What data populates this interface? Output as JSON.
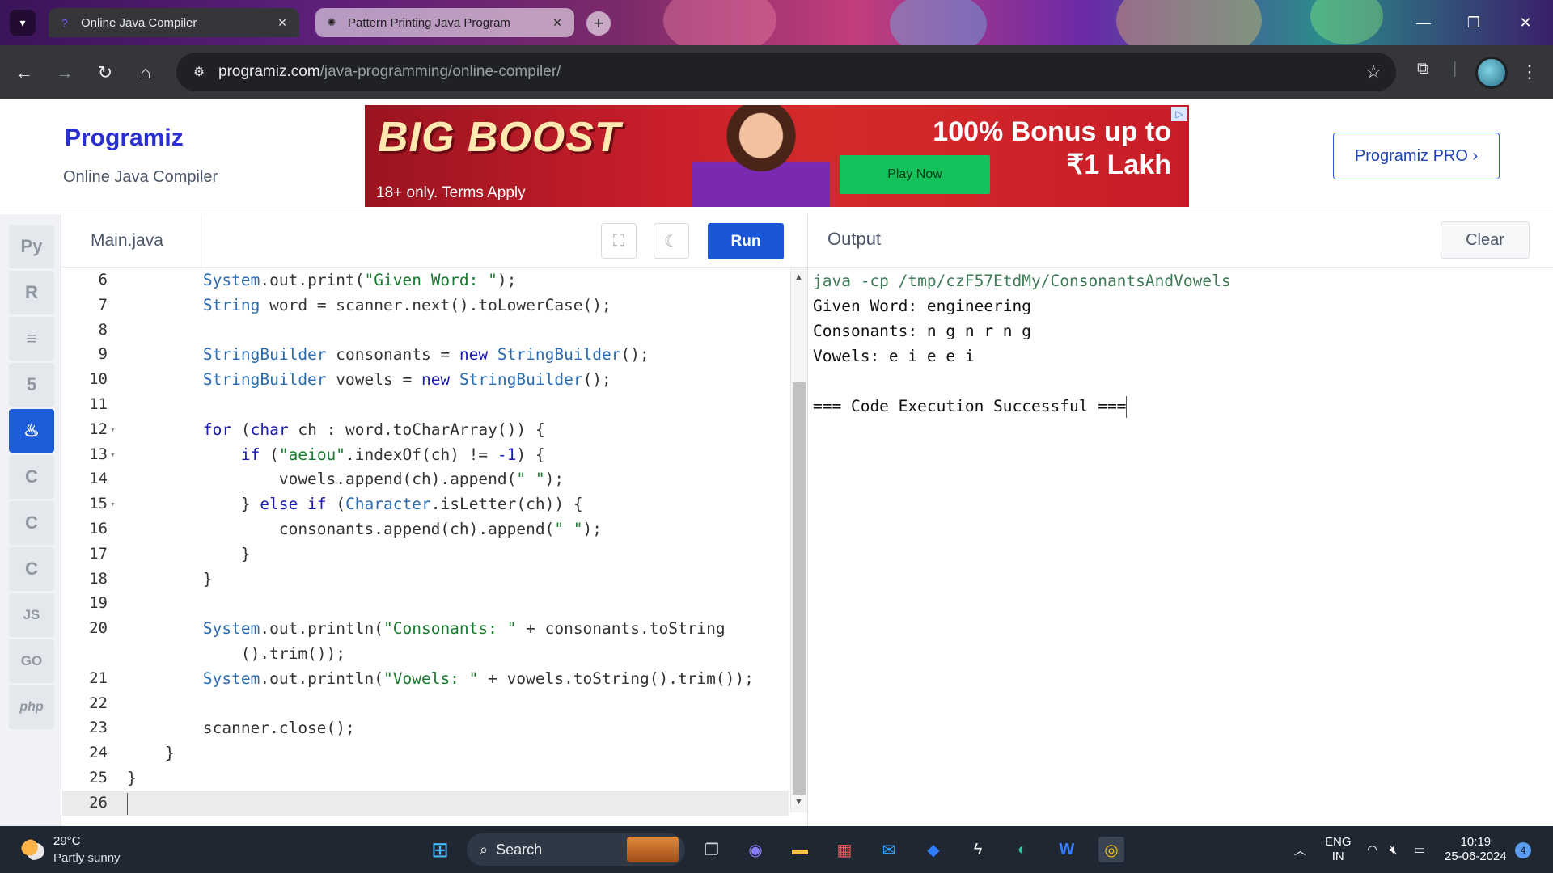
{
  "browser": {
    "tabs": [
      {
        "title": "Online Java Compiler",
        "active": true
      },
      {
        "title": "Pattern Printing Java Program",
        "active": false
      }
    ],
    "url_host": "programiz.com",
    "url_path": "/java-programming/online-compiler/"
  },
  "header": {
    "logo": "Programiz",
    "subtitle": "Online Java Compiler",
    "pro_button": "Programiz PRO ›"
  },
  "ad": {
    "headline": "BIG BOOST",
    "terms": "18+ only. Terms Apply",
    "cta": "Play Now",
    "bonus_line1": "100% Bonus up to",
    "bonus_line2": "₹1 Lakh"
  },
  "languages": [
    {
      "name": "python-icon",
      "label": "Py",
      "active": false
    },
    {
      "name": "r-icon",
      "label": "R",
      "active": false
    },
    {
      "name": "sql-icon",
      "label": "≡",
      "active": false
    },
    {
      "name": "html-icon",
      "label": "5",
      "active": false
    },
    {
      "name": "java-icon",
      "label": "♨",
      "active": true
    },
    {
      "name": "c-icon",
      "label": "C",
      "active": false
    },
    {
      "name": "cpp-icon",
      "label": "C",
      "active": false
    },
    {
      "name": "csharp-icon",
      "label": "C",
      "active": false
    },
    {
      "name": "js-icon",
      "label": "JS",
      "active": false
    },
    {
      "name": "go-icon",
      "label": "GO",
      "active": false
    },
    {
      "name": "php-icon",
      "label": "php",
      "active": false
    }
  ],
  "editor": {
    "file_name": "Main.java",
    "run_label": "Run"
  },
  "output": {
    "title": "Output",
    "clear_label": "Clear",
    "lines": [
      {
        "text": "java -cp /tmp/czF57EtdMy/ConsonantsAndVowels",
        "type": "cmd"
      },
      {
        "text": "Given Word: engineering",
        "type": "out"
      },
      {
        "text": "Consonants: n g n r n g",
        "type": "out"
      },
      {
        "text": "Vowels: e i e e i",
        "type": "out"
      },
      {
        "text": "",
        "type": "out"
      },
      {
        "text": "=== Code Execution Successful ===",
        "type": "out"
      }
    ]
  },
  "taskbar": {
    "temperature": "29°C",
    "condition": "Partly sunny",
    "search_label": "Search",
    "lang_top": "ENG",
    "lang_bottom": "IN",
    "time": "10:19",
    "date": "25-06-2024",
    "notifications": "4"
  },
  "code_lines": [
    {
      "n": "6",
      "fold": false,
      "html": "        <span class=\"cls\">System</span>.out.print(<span class=\"str\">\"Given Word: \"</span>);"
    },
    {
      "n": "7",
      "fold": false,
      "html": "        <span class=\"cls\">String</span> word = scanner.next().toLowerCase();"
    },
    {
      "n": "8",
      "fold": false,
      "html": ""
    },
    {
      "n": "9",
      "fold": false,
      "html": "        <span class=\"cls\">StringBuilder</span> consonants = <span class=\"kw\">new</span> <span class=\"cls\">StringBuilder</span>();"
    },
    {
      "n": "10",
      "fold": false,
      "html": "        <span class=\"cls\">StringBuilder</span> vowels = <span class=\"kw\">new</span> <span class=\"cls\">StringBuilder</span>();"
    },
    {
      "n": "11",
      "fold": false,
      "html": ""
    },
    {
      "n": "12",
      "fold": true,
      "html": "        <span class=\"kw\">for</span> (<span class=\"kw\">char</span> ch : word.toCharArray()) {"
    },
    {
      "n": "13",
      "fold": true,
      "html": "            <span class=\"kw\">if</span> (<span class=\"str\">\"aeiou\"</span>.indexOf(ch) != <span class=\"num\">-1</span>) {"
    },
    {
      "n": "14",
      "fold": false,
      "html": "                vowels.append(ch).append(<span class=\"str\">\" \"</span>);"
    },
    {
      "n": "15",
      "fold": true,
      "html": "            } <span class=\"kw\">else</span> <span class=\"kw\">if</span> (<span class=\"cls\">Character</span>.isLetter(ch)) {"
    },
    {
      "n": "16",
      "fold": false,
      "html": "                consonants.append(ch).append(<span class=\"str\">\" \"</span>);"
    },
    {
      "n": "17",
      "fold": false,
      "html": "            }"
    },
    {
      "n": "18",
      "fold": false,
      "html": "        }"
    },
    {
      "n": "19",
      "fold": false,
      "html": ""
    },
    {
      "n": "20",
      "fold": false,
      "html": "        <span class=\"cls\">System</span>.out.println(<span class=\"str\">\"Consonants: \"</span> + consonants.toString"
    },
    {
      "n": "",
      "fold": false,
      "html": "            ().trim());"
    },
    {
      "n": "21",
      "fold": false,
      "html": "        <span class=\"cls\">System</span>.out.println(<span class=\"str\">\"Vowels: \"</span> + vowels.toString().trim());"
    },
    {
      "n": "22",
      "fold": false,
      "html": ""
    },
    {
      "n": "23",
      "fold": false,
      "html": "        scanner.close();"
    },
    {
      "n": "24",
      "fold": false,
      "html": "    }"
    },
    {
      "n": "25",
      "fold": false,
      "html": "}"
    },
    {
      "n": "26",
      "fold": false,
      "html": "",
      "current": true
    }
  ]
}
